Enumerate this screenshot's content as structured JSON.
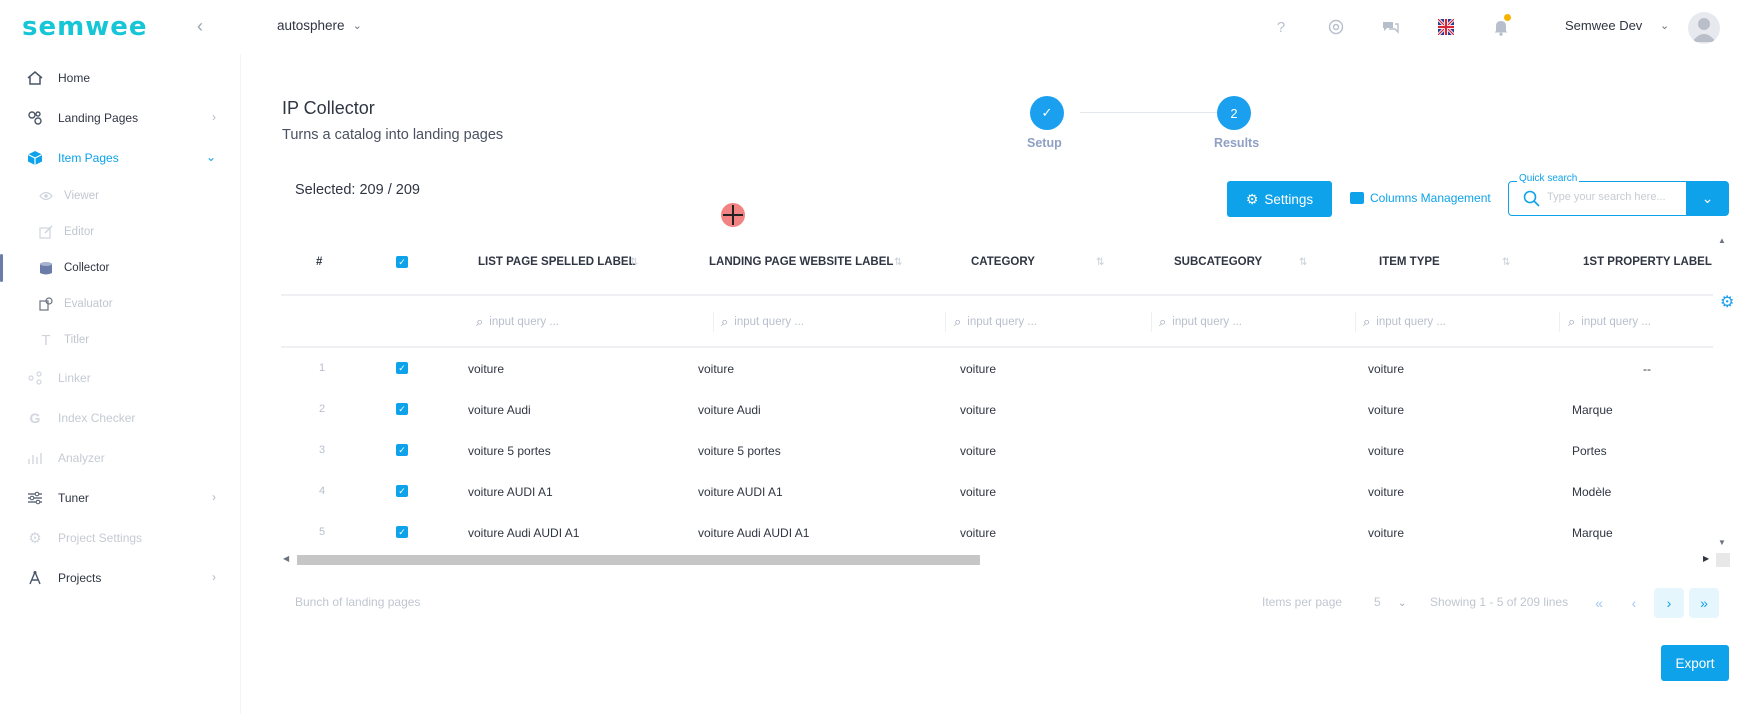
{
  "brand": {
    "logo_text": "semwee",
    "accent": "#0ea2ea",
    "logo_color": "#17c6d6",
    "notification_dot": "#f6b400"
  },
  "sidebar": {
    "items": [
      {
        "label": "Home",
        "icon": "home-icon"
      },
      {
        "label": "Landing Pages",
        "icon": "landing-pages-icon"
      },
      {
        "label": "Item Pages",
        "icon": "cube-icon"
      },
      {
        "label": "Linker",
        "icon": "linker-icon"
      },
      {
        "label": "Index Checker",
        "icon": "google-icon"
      },
      {
        "label": "Analyzer",
        "icon": "analyzer-icon"
      },
      {
        "label": "Tuner",
        "icon": "sliders-icon"
      },
      {
        "label": "Project Settings",
        "icon": "gear-icon"
      },
      {
        "label": "Projects",
        "icon": "projects-icon"
      }
    ],
    "subitems": [
      {
        "label": "Viewer",
        "icon": "eye-icon"
      },
      {
        "label": "Editor",
        "icon": "edit-icon"
      },
      {
        "label": "Collector",
        "icon": "collector-icon"
      },
      {
        "label": "Evaluator",
        "icon": "evaluator-icon"
      },
      {
        "label": "Titler",
        "icon": "text-icon"
      }
    ]
  },
  "topbar": {
    "project": "autosphere",
    "user": "Semwee Dev"
  },
  "header": {
    "title": "IP Collector",
    "subtitle": "Turns a catalog into landing pages",
    "steps": [
      {
        "label": "Setup",
        "marker": "✓"
      },
      {
        "label": "Results",
        "marker": "2"
      }
    ]
  },
  "toolbar": {
    "selected": "Selected: 209 / 209",
    "settings_label": "Settings",
    "columns_label": "Columns Management",
    "search_legend": "Quick search",
    "search_placeholder": "Type your search here..."
  },
  "table": {
    "headers": [
      "#",
      "LIST PAGE SPELLED LABEL",
      "LANDING PAGE WEBSITE LABEL",
      "CATEGORY",
      "SUBCATEGORY",
      "ITEM TYPE",
      "1ST PROPERTY LABEL"
    ],
    "filter_placeholder": "input query ...",
    "rows": [
      {
        "idx": "1",
        "list_label": "voiture",
        "website_label": "voiture",
        "category": "voiture",
        "subcategory": "",
        "item_type": "voiture",
        "property": "--"
      },
      {
        "idx": "2",
        "list_label": "voiture Audi",
        "website_label": "voiture Audi",
        "category": "voiture",
        "subcategory": "",
        "item_type": "voiture",
        "property": "Marque"
      },
      {
        "idx": "3",
        "list_label": "voiture 5 portes",
        "website_label": "voiture 5 portes",
        "category": "voiture",
        "subcategory": "",
        "item_type": "voiture",
        "property": "Portes"
      },
      {
        "idx": "4",
        "list_label": "voiture AUDI A1",
        "website_label": "voiture AUDI A1",
        "category": "voiture",
        "subcategory": "",
        "item_type": "voiture",
        "property": "Modèle"
      },
      {
        "idx": "5",
        "list_label": "voiture Audi AUDI A1",
        "website_label": "voiture Audi AUDI A1",
        "category": "voiture",
        "subcategory": "",
        "item_type": "voiture",
        "property": "Marque"
      }
    ]
  },
  "footer": {
    "note": "Bunch of landing pages",
    "items_per_page_label": "Items per page",
    "items_per_page": "5",
    "showing": "Showing 1 - 5 of 209 lines"
  },
  "export_label": "Export"
}
